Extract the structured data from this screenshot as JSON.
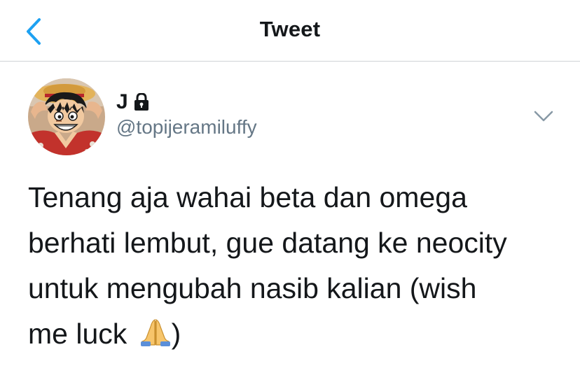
{
  "header": {
    "back_icon": "chevron-left-icon",
    "title": "Tweet"
  },
  "author": {
    "display_name": "J",
    "lock_icon": "lock-icon",
    "handle": "@topijeramiluffy",
    "avatar_icon": "avatar-image"
  },
  "tweet": {
    "more_icon": "chevron-down-icon",
    "text_before_emoji": "Tenang aja wahai beta dan omega\nberhati lembut, gue datang ke neocity\nuntuk mengubah nasib kalian (wish\nme luck",
    "emoji_icon": "folded-hands-icon",
    "text_after_emoji": ")"
  },
  "colors": {
    "accent": "#1da1f2",
    "text": "#14171a",
    "secondary_text": "#657786",
    "divider": "#d0d3d6"
  }
}
